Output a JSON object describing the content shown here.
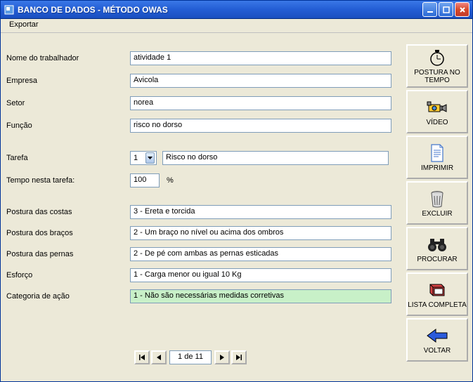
{
  "titlebar": {
    "title": "BANCO DE DADOS - MÉTODO OWAS"
  },
  "menu": {
    "exportar": "Exportar"
  },
  "labels": {
    "nome_trabalhador": "Nome do trabalhador",
    "empresa": "Empresa",
    "setor": "Setor",
    "funcao": "Função",
    "tarefa": "Tarefa",
    "tempo_tarefa": "Tempo nesta tarefa:",
    "postura_costas": "Postura das costas",
    "postura_bracos": "Postura dos braços",
    "postura_pernas": "Postura das pernas",
    "esforco": "Esforço",
    "categoria_acao": "Categoria de ação",
    "percent": "%"
  },
  "fields": {
    "nome_trabalhador": "atividade 1",
    "empresa": "Avicola",
    "setor": "norea",
    "funcao": "risco no dorso",
    "tarefa_num": "1",
    "tarefa_desc": "Risco no dorso",
    "tempo_tarefa": "100",
    "postura_costas": "3 - Ereta e torcida",
    "postura_bracos": "2 - Um braço no nível ou acima dos ombros",
    "postura_pernas": "2 - De pé com ambas as pernas esticadas",
    "esforco": "1 - Carga menor ou igual 10 Kg",
    "categoria_acao": "1 - Não são necessárias medidas corretivas"
  },
  "sidebar": {
    "postura_tempo": "POSTURA NO TEMPO",
    "video": "VÍDEO",
    "imprimir": "IMPRIMIR",
    "excluir": "EXCLUIR",
    "procurar": "PROCURAR",
    "lista_completa": "LISTA COMPLETA",
    "voltar": "VOLTAR"
  },
  "pager": {
    "position": "1 de 11"
  }
}
